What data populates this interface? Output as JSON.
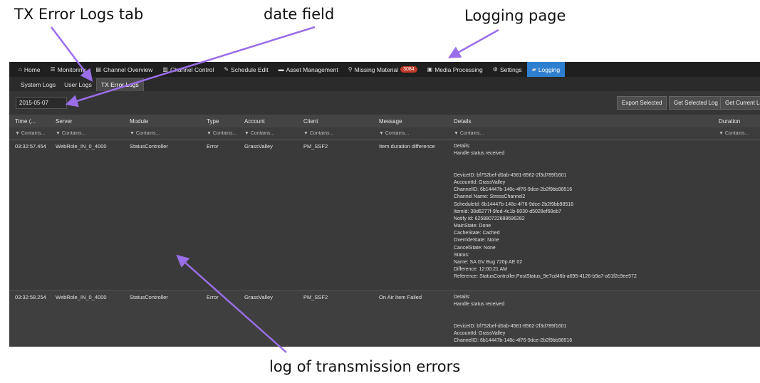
{
  "callouts": {
    "tx_error_logs_tab": "TX Error Logs tab",
    "date_field": "date field",
    "logging_page": "Logging page",
    "log_of_transmission_errors": "log of transmission errors"
  },
  "colors": {
    "arrow": "#9a6ee8",
    "active_nav": "#2f7fd0",
    "badge": "#c0392b"
  },
  "nav": {
    "items": [
      {
        "icon": "home-icon",
        "glyph": "⌂",
        "label": "Home"
      },
      {
        "icon": "monitor-icon",
        "glyph": "☰",
        "label": "Monitoring"
      },
      {
        "icon": "channel-overview-icon",
        "glyph": "▤",
        "label": "Channel Overview"
      },
      {
        "icon": "channel-control-icon",
        "glyph": "▥",
        "label": "Channel Control"
      },
      {
        "icon": "edit-icon",
        "glyph": "✎",
        "label": "Schedule Edit"
      },
      {
        "icon": "folder-icon",
        "glyph": "▬",
        "label": "Asset Management"
      },
      {
        "icon": "search-icon",
        "glyph": "⚲",
        "label": "Missing Material"
      },
      {
        "icon": "film-icon",
        "glyph": "▣",
        "label": "Media Processing"
      },
      {
        "icon": "gear-icon",
        "glyph": "⚙",
        "label": "Settings"
      },
      {
        "icon": "logging-icon",
        "glyph": "▰",
        "label": "Logging"
      }
    ],
    "missing_material_badge": "3084"
  },
  "subtabs": [
    "System Logs",
    "User Logs",
    "TX Error Logs"
  ],
  "toolbar": {
    "date_value": "2015-05-07",
    "export_selected": "Export Selected",
    "get_selected_log": "Get Selected Log",
    "get_current_log": "Get Current Lo"
  },
  "table": {
    "columns": [
      "Time (...",
      "Server",
      "Module",
      "Type",
      "Account",
      "Client",
      "Message",
      "Details",
      "Duration"
    ],
    "filter_placeholder": "▼ Contains...",
    "rows": [
      {
        "time": "03:32:57.454",
        "server": "WebRole_IN_0_4000",
        "module": "StatusController",
        "type": "Error",
        "account": "GrassValley",
        "client": "PM_SSF2",
        "message": "Item duration difference",
        "details": [
          "Details:",
          "Handle status received",
          "",
          "",
          "DeviceID: bf752bef-d0ab-4581-8562-2f3d789f1601",
          "AccountId: GrassValley",
          "ChannelID: 6b14447b-148c-4f76-9dce-2b2f9bb98516",
          "Channel Name: StressChannel2",
          "ScheduleId: 6b14447b-148c-4f76-9dce-2b2f9bb98516",
          "ItemId: 38d6277f-9fed-4c1b-8030-d5028ef68eb7",
          "Notify Id: 625880722688696282",
          "MainState: Done",
          "CacheState: Cached",
          "OverrideState: None",
          "CancelState: None",
          "Status:",
          "Name: SA GV Bug 720p AE 02",
          "Difference: 12:00:21 AM",
          "Reference: StatusController.PostStatus_9e7cd46b-a695-4126-b9a7-a51f2c9ee572"
        ]
      },
      {
        "time": "03:32:58.254",
        "server": "WebRole_IN_0_4000",
        "module": "StatusController",
        "type": "Error",
        "account": "GrassValley",
        "client": "PM_SSF2",
        "message": "On Air Item Failed",
        "details": [
          "Details:",
          "Handle status received",
          "",
          "",
          "DeviceID: bf752bef-d0ab-4581-8562-2f3d789f1601",
          "AccountId: GrassValley",
          "ChannelID: 6b14447b-148c-4f76-9dce-2b2f9bb98516"
        ]
      }
    ]
  }
}
